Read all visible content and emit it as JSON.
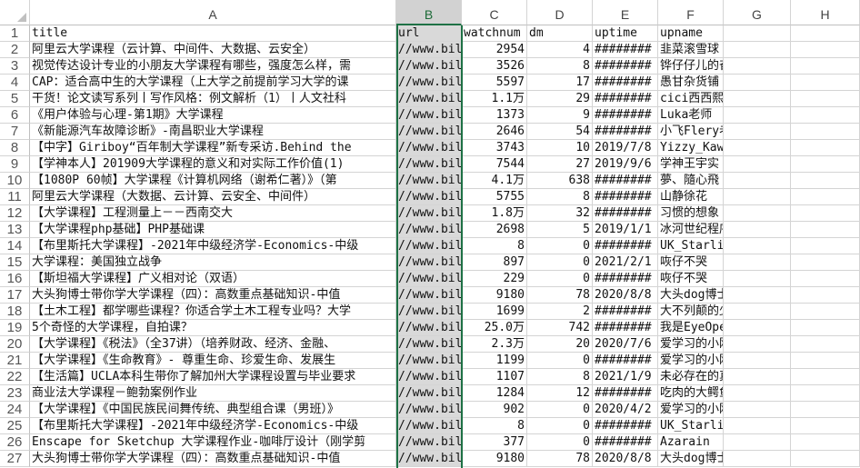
{
  "columns": [
    "A",
    "B",
    "C",
    "D",
    "E",
    "F",
    "G",
    "H"
  ],
  "selected_column": "B",
  "rows": [
    {
      "n": "1",
      "a": "title",
      "b": "url",
      "c": "watchnum",
      "d": "dm",
      "e": "uptime",
      "f": "upname"
    },
    {
      "n": "2",
      "a": "阿里云大学课程（云计算、中间件、大数据、云安全）",
      "b": "//www.bil",
      "c": "2954",
      "d": "4",
      "e": "########",
      "f": "韭菜滚雪球"
    },
    {
      "n": "3",
      "a": "视觉传达设计专业的小朋友大学课程有哪些，强度怎么样，需",
      "b": "//www.bil",
      "c": "3526",
      "d": "8",
      "e": "########",
      "f": "铧仔仔儿的奋斗史"
    },
    {
      "n": "4",
      "a": "CAP：适合高中生的大学课程（上大学之前提前学习大学的课",
      "b": "//www.bil",
      "c": "5597",
      "d": "17",
      "e": "########",
      "f": "愚甘杂货铺"
    },
    {
      "n": "5",
      "a": "干货！论文读写系列丨写作风格：例文解析（1）丨人文社科",
      "b": "//www.bil",
      "c": "1.1万",
      "d": "29",
      "e": "########",
      "f": "cici西西熙熙"
    },
    {
      "n": "6",
      "a": "《用户体验与心理-第1期》大学课程",
      "b": "//www.bil",
      "c": "1373",
      "d": "9",
      "e": "########",
      "f": "Luka老师"
    },
    {
      "n": "7",
      "a": "《新能源汽车故障诊断》-南昌职业大学课程",
      "b": "//www.bil",
      "c": "2646",
      "d": "54",
      "e": "########",
      "f": "小飞Flery老师"
    },
    {
      "n": "8",
      "a": "【中字】Giriboy“百年制大学课程”新专采访.Behind the",
      "b": "//www.bil",
      "c": "3743",
      "d": "10",
      "e": "2019/7/8",
      "f": "Yizzy_Kawasaki"
    },
    {
      "n": "9",
      "a": "【学神本人】201909大学课程的意义和对实际工作价值(1)",
      "b": "//www.bil",
      "c": "7544",
      "d": "27",
      "e": "2019/9/6",
      "f": "学神王宇实"
    },
    {
      "n": "10",
      "a": "【1080P 60帧】大学课程《计算机网络（谢希仁著）》（第",
      "b": "//www.bil",
      "c": "4.1万",
      "d": "638",
      "e": "########",
      "f": "夢、隨心飛"
    },
    {
      "n": "11",
      "a": "阿里云大学课程（大数据、云计算、云安全、中间件）",
      "b": "//www.bil",
      "c": "5755",
      "d": "8",
      "e": "########",
      "f": "山静徐花"
    },
    {
      "n": "12",
      "a": "【大学课程】工程测量上－－西南交大",
      "b": "//www.bil",
      "c": "1.8万",
      "d": "32",
      "e": "########",
      "f": "习惯的想象"
    },
    {
      "n": "13",
      "a": "【大学课程php基础】PHP基础课",
      "b": "//www.bil",
      "c": "2698",
      "d": "5",
      "e": "2019/1/1",
      "f": "冰河世纪程序猿"
    },
    {
      "n": "14",
      "a": "【布里斯托大学课程】-2021年中级经济学-Economics-中级",
      "b": "//www.bil",
      "c": "8",
      "d": "0",
      "e": "########",
      "f": "UK_Starlight"
    },
    {
      "n": "15",
      "a": "大学课程：美国独立战争",
      "b": "//www.bil",
      "c": "897",
      "d": "0",
      "e": "2021/2/1",
      "f": "咴仔不哭"
    },
    {
      "n": "16",
      "a": "【斯坦福大学课程】广义相对论（双语）",
      "b": "//www.bil",
      "c": "229",
      "d": "0",
      "e": "########",
      "f": "咴仔不哭"
    },
    {
      "n": "17",
      "a": "大头狗博士带你学大学课程（四）：高数重点基础知识-中值",
      "b": "//www.bil",
      "c": "9180",
      "d": "78",
      "e": "2020/8/8",
      "f": "大头dog博士和朋友们"
    },
    {
      "n": "18",
      "a": "【土木工程】都学哪些课程？你适合学土木工程专业吗？大学",
      "b": "//www.bil",
      "c": "1699",
      "d": "2",
      "e": "########",
      "f": "大不列颠的少女"
    },
    {
      "n": "19",
      "a": "5个奇怪的大学课程，自拍课？",
      "b": "//www.bil",
      "c": "25.0万",
      "d": "742",
      "e": "########",
      "f": "我是EyeOpener"
    },
    {
      "n": "20",
      "a": "【大学课程】《税法》（全37讲）（培养财政、经济、金融、",
      "b": "//www.bil",
      "c": "2.3万",
      "d": "20",
      "e": "2020/7/6",
      "f": "爱学习的小刚子"
    },
    {
      "n": "21",
      "a": "【大学课程】《生命教育》- 尊重生命、珍爱生命、发展生",
      "b": "//www.bil",
      "c": "1199",
      "d": "0",
      "e": "########",
      "f": "爱学习的小刚子"
    },
    {
      "n": "22",
      "a": "【生活篇】UCLA本科生带你了解加州大学课程设置与毕业要求",
      "b": "//www.bil",
      "c": "1107",
      "d": "8",
      "e": "2021/1/9",
      "f": "未必存在的真理"
    },
    {
      "n": "23",
      "a": "商业法大学课程－鲍勃案例作业",
      "b": "//www.bil",
      "c": "1284",
      "d": "12",
      "e": "########",
      "f": "吃肉的大鳄鱼"
    },
    {
      "n": "24",
      "a": "【大学课程】《中国民族民间舞传统、典型组合课（男班）》",
      "b": "//www.bil",
      "c": "902",
      "d": "0",
      "e": "2020/4/2",
      "f": "爱学习的小刚子"
    },
    {
      "n": "25",
      "a": "【布里斯托大学课程】-2021年中级经济学-Economics-中级",
      "b": "//www.bil",
      "c": "8",
      "d": "0",
      "e": "########",
      "f": "UK_Starlight"
    },
    {
      "n": "26",
      "a": "Enscape for Sketchup 大学课程作业-咖啡厅设计（刚学剪",
      "b": "//www.bil",
      "c": "377",
      "d": "0",
      "e": "########",
      "f": "Azarain"
    },
    {
      "n": "27",
      "a": "大头狗博士带你学大学课程（四）：高数重点基础知识-中值",
      "b": "//www.bil",
      "c": "9180",
      "d": "78",
      "e": "2020/8/8",
      "f": "大头dog博士和朋友们"
    }
  ]
}
